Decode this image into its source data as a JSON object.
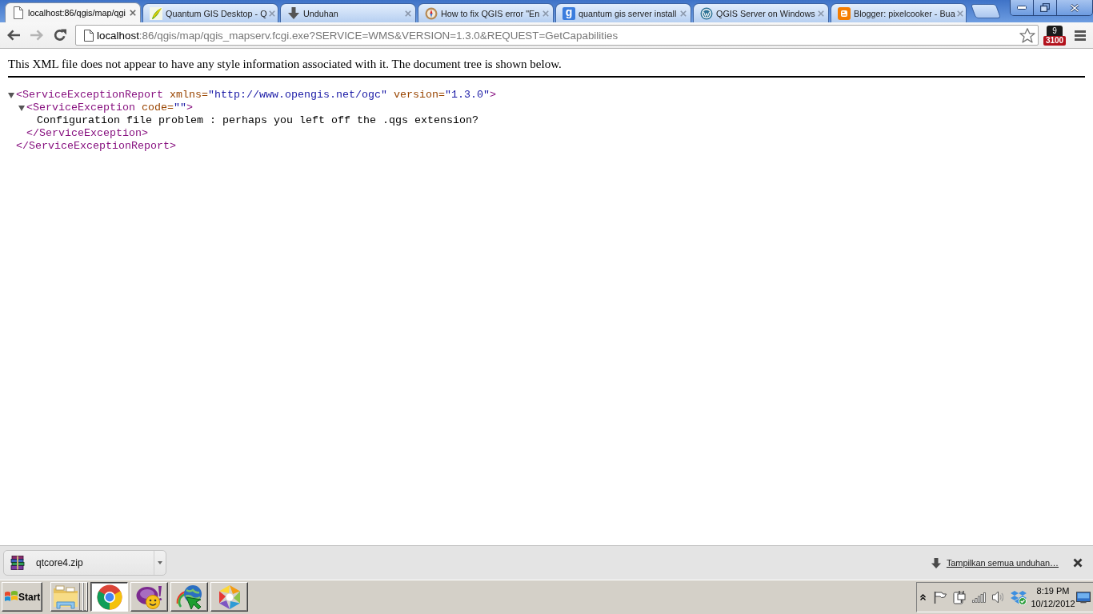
{
  "tabs": [
    {
      "title": "localhost:86/qgis/map/qgi",
      "selected": true
    },
    {
      "title": "Quantum GIS Desktop - Q",
      "selected": false
    },
    {
      "title": "Unduhan",
      "selected": false
    },
    {
      "title": "How to fix QGIS error \"En",
      "selected": false
    },
    {
      "title": "quantum gis server install",
      "selected": false,
      "favicon_text": "g"
    },
    {
      "title": "QGIS Server on Windows",
      "selected": false
    },
    {
      "title": "Blogger: pixelcooker - Bua",
      "selected": false
    }
  ],
  "toolbar": {
    "nav_buttons": [
      {
        "disabled": false
      },
      {
        "disabled": true
      },
      {
        "disabled": false
      }
    ],
    "address": {
      "host": "localhost",
      "path": ":86/qgis/map/qgis_mapserv.fcgi.exe?SERVICE=WMS&VERSION=1.3.0&REQUEST=GetCapabilities"
    },
    "extension": {
      "label": "9",
      "badge": "3100"
    }
  },
  "page": {
    "notice": "This XML file does not appear to have any style information associated with it. The document tree is shown below.",
    "xml_tree": [
      {
        "kind": "element",
        "expanded": true,
        "open": "<ServiceExceptionReport",
        "attributes": [
          {
            "name": "xmlns=",
            "value": "\"http://www.opengis.net/ogc\""
          },
          {
            "name": "version=",
            "value": "\"1.3.0\""
          }
        ],
        "open_end": ">",
        "close": "</ServiceExceptionReport>",
        "children": [
          {
            "kind": "element",
            "expanded": true,
            "open": "<ServiceException",
            "attributes": [
              {
                "name": "code=",
                "value": "\"\""
              }
            ],
            "open_end": ">",
            "close": "</ServiceException>",
            "children": [
              {
                "kind": "text",
                "text": "Configuration file problem : perhaps you left off the .qgs extension?"
              }
            ]
          }
        ]
      }
    ]
  },
  "download_shelf": {
    "items": [
      {
        "file_name": "qtcore4.zip"
      }
    ],
    "show_all_link": "Tampilkan semua unduhan…"
  },
  "taskbar": {
    "start_label": "Start",
    "buttons": [
      {
        "selected": false,
        "grouped": true
      },
      {
        "selected": true,
        "grouped": false
      },
      {
        "selected": false,
        "grouped": false
      },
      {
        "selected": false,
        "grouped": false
      },
      {
        "selected": false,
        "grouped": false
      }
    ],
    "clock": {
      "time": "8:19 PM",
      "date": "10/12/2012"
    }
  }
}
